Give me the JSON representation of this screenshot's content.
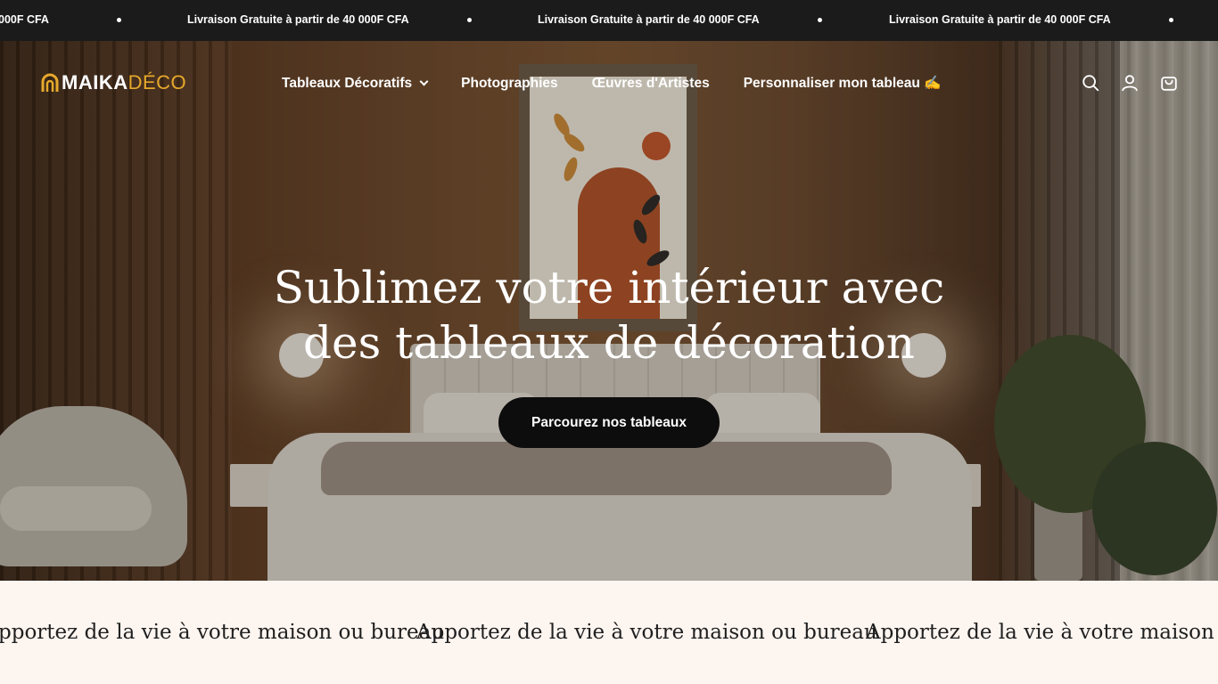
{
  "announcement": {
    "messages": [
      "000F CFA",
      "Livraison Gratuite à partir de 40 000F CFA",
      "Livraison Gratuite à partir de 40 000F CFA",
      "Livraison Gratuite à partir de 40 000F CFA"
    ]
  },
  "header": {
    "logo_primary": "MAIKA",
    "logo_secondary": "DÉCO",
    "nav": [
      {
        "label": "Tableaux Décoratifs",
        "has_dropdown": true
      },
      {
        "label": "Photographies"
      },
      {
        "label": "Œuvres d'Artistes"
      },
      {
        "label": "Personnaliser mon tableau ✍️"
      }
    ],
    "icons": [
      "search-icon",
      "account-icon",
      "cart-icon"
    ]
  },
  "hero": {
    "title_line1": "Sublimez votre intérieur avec",
    "title_line2": "des tableaux de décoration",
    "cta_label": "Parcourez nos tableaux"
  },
  "marquee": {
    "items": [
      "pportez de la vie à votre maison ou bureau",
      "Apportez de la vie à votre maison ou bureau",
      "Apportez de la vie à votre maison ou bureau"
    ]
  },
  "colors": {
    "announcement_bg": "#1b1b1b",
    "accent_logo": "#e7a92c",
    "cta_bg": "#0d0d0d",
    "marquee_bg": "#fdf5f0"
  }
}
